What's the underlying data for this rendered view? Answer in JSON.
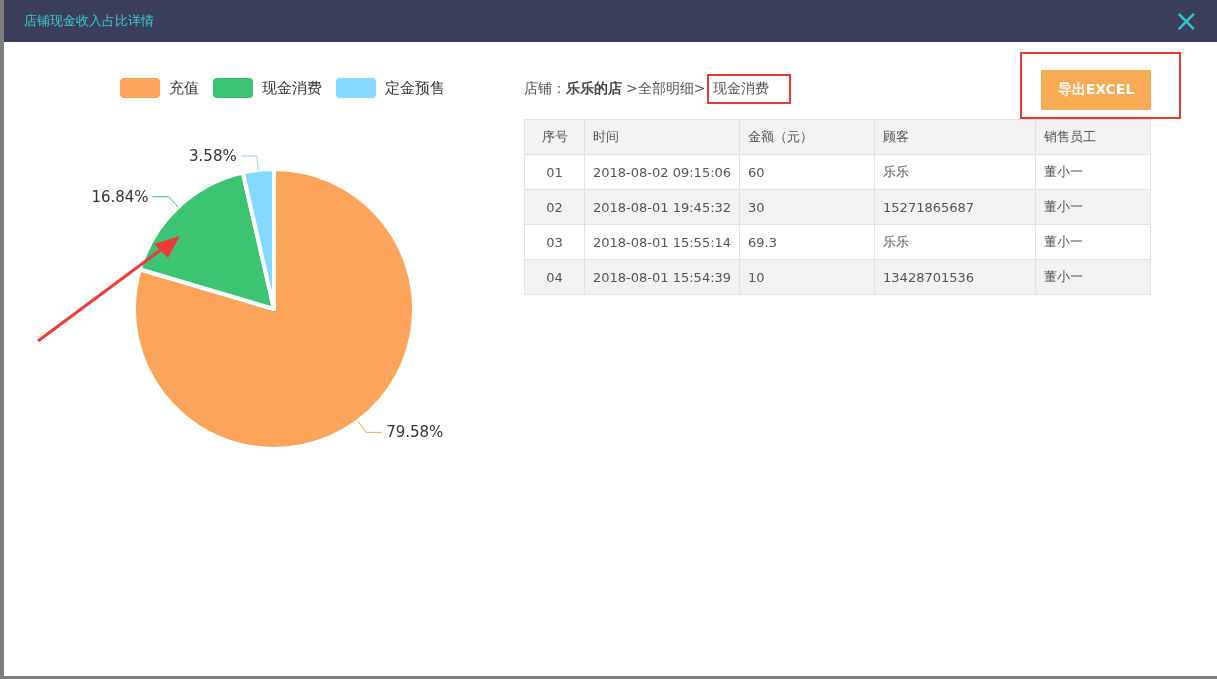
{
  "window": {
    "title": "店铺现金收入占比详情",
    "close": "×"
  },
  "legend": [
    {
      "color": "#fca55a"
    },
    {
      "color": "#3cc472"
    },
    {
      "color": "#86d9fe"
    }
  ],
  "chart_data": {
    "type": "pie",
    "categories": [
      "充值",
      "现金消费",
      "定金预售"
    ],
    "values": [
      79.58,
      16.84,
      3.58
    ],
    "value_labels": [
      "79.58%",
      "16.84%",
      "3.58%"
    ]
  },
  "markup": [
    {
      "kind": "arrow"
    }
  ],
  "breadcrumb": {
    "label": "店铺：",
    "store": "乐乐的店",
    "path": ">全部明细>",
    "current": "现金消费",
    "highlight": true
  },
  "export_button": {
    "label": "导出EXCEL",
    "highlight": true
  },
  "table": {
    "columns": [
      "序号",
      "时间",
      "金额（元）",
      "顾客",
      "销售员工"
    ],
    "rows": [
      [
        "01",
        "2018-08-02 09:15:06",
        "60",
        "乐乐",
        "董小一"
      ],
      [
        "02",
        "2018-08-01 19:45:32",
        "30",
        "15271865687",
        "董小一"
      ],
      [
        "03",
        "2018-08-01 15:55:14",
        "69.3",
        "乐乐",
        "董小一"
      ],
      [
        "04",
        "2018-08-01 15:54:39",
        "10",
        "13428701536",
        "董小一"
      ]
    ]
  }
}
